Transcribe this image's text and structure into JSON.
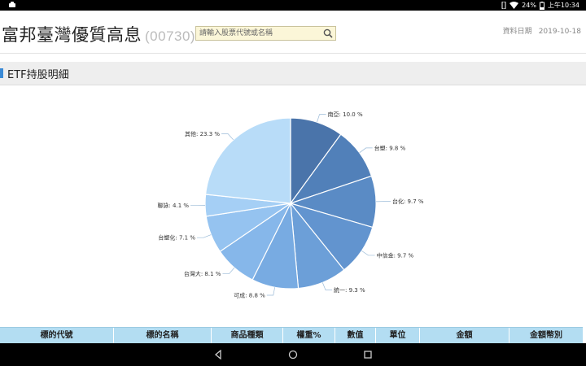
{
  "status_bar": {
    "battery": "24%",
    "time": "上午10:34"
  },
  "header": {
    "title": "富邦臺灣優質高息",
    "code": "(00730)",
    "search_placeholder": "請輸入股票代號或名稱",
    "date_label": "資料日期",
    "date_value": "2019-10-18"
  },
  "section": {
    "title": "ETF持股明細"
  },
  "chart_data": {
    "type": "pie",
    "slices": [
      {
        "label": "南亞: 10.0 %",
        "value": 10.0,
        "color": "#4a74aa"
      },
      {
        "label": "台塑: 9.8 %",
        "value": 9.8,
        "color": "#5180b9"
      },
      {
        "label": "台化: 9.7 %",
        "value": 9.7,
        "color": "#5a8bc5"
      },
      {
        "label": "中信金: 9.7 %",
        "value": 9.7,
        "color": "#6294cf"
      },
      {
        "label": "統一: 9.3 %",
        "value": 9.3,
        "color": "#6c9fd8"
      },
      {
        "label": "可成: 8.8 %",
        "value": 8.8,
        "color": "#78abe2"
      },
      {
        "label": "台灣大: 8.1 %",
        "value": 8.1,
        "color": "#86b7ea"
      },
      {
        "label": "台塑化: 7.1 %",
        "value": 7.1,
        "color": "#95c3f0"
      },
      {
        "label": "聯詠: 4.1 %",
        "value": 4.1,
        "color": "#a5cff5"
      },
      {
        "label": "其他: 23.3 %",
        "value": 23.3,
        "color": "#b8dcf8"
      }
    ]
  },
  "table": {
    "headers": [
      "標的代號",
      "標的名稱",
      "商品種類",
      "權重%",
      "數值",
      "單位",
      "金額",
      "金額幣別"
    ]
  }
}
